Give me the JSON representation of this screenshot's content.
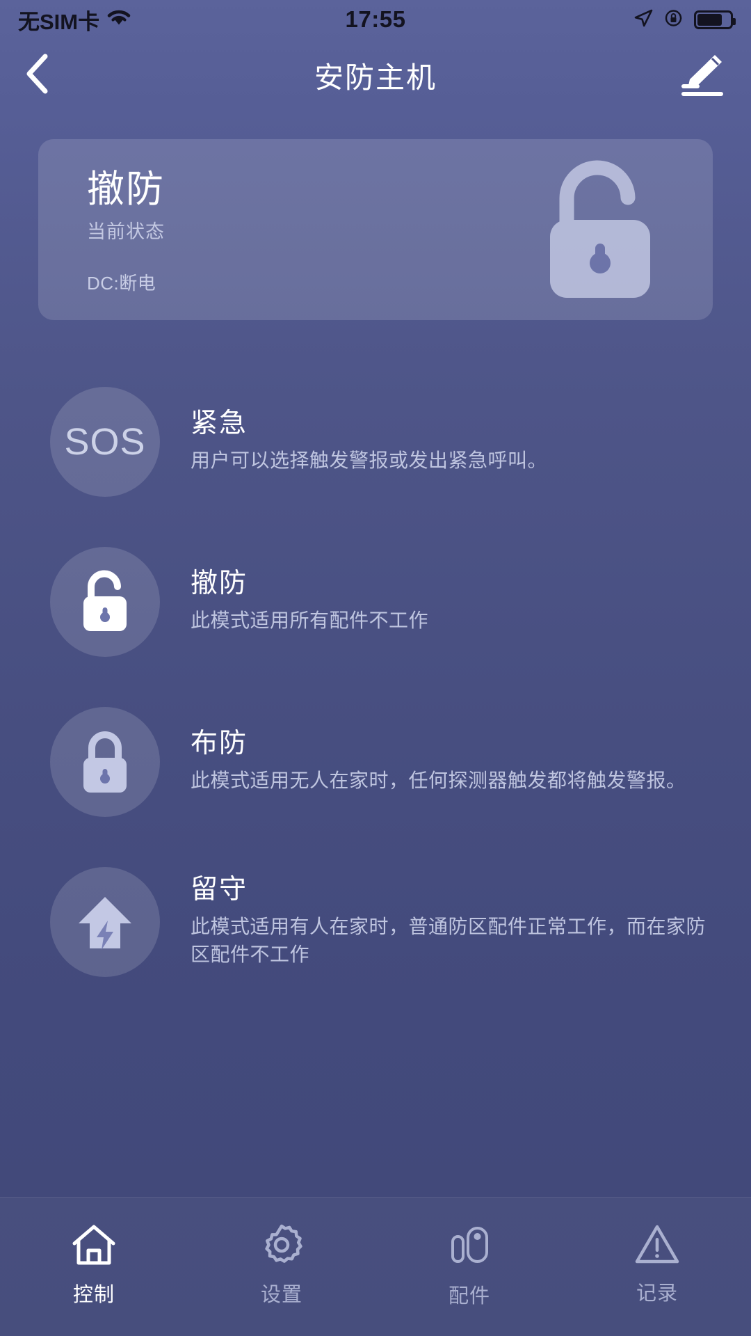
{
  "status_bar": {
    "carrier": "无SIM卡",
    "wifi_icon": "wifi-icon",
    "time": "17:55",
    "location_icon": "location-arrow-icon",
    "rotation_lock_icon": "rotation-lock-icon",
    "battery_icon": "battery-icon",
    "battery_level_pct": 75
  },
  "header": {
    "back_icon": "chevron-left-icon",
    "title": "安防主机",
    "edit_icon": "edit-pencil-icon"
  },
  "status_card": {
    "state": "撤防",
    "sub_label": "当前状态",
    "power_status": "DC:断电",
    "icon": "unlock-open-padlock-icon"
  },
  "modes": [
    {
      "icon": "sos-icon",
      "icon_text": "SOS",
      "title": "紧急",
      "desc": "用户可以选择触发警报或发出紧急呼叫。",
      "active": false
    },
    {
      "icon": "unlock-open-padlock-icon",
      "icon_text": "",
      "title": "撤防",
      "desc": "此模式适用所有配件不工作",
      "active": true
    },
    {
      "icon": "lock-closed-padlock-icon",
      "icon_text": "",
      "title": "布防",
      "desc": "此模式适用无人在家时，任何探测器触发都将触发警报。",
      "active": false
    },
    {
      "icon": "home-bolt-icon",
      "icon_text": "",
      "title": "留守",
      "desc": "此模式适用有人在家时，普通防区配件正常工作，而在家防区配件不工作",
      "active": false
    }
  ],
  "tabs": [
    {
      "icon": "home-icon",
      "label": "控制",
      "active": true
    },
    {
      "icon": "gear-icon",
      "label": "设置",
      "active": false
    },
    {
      "icon": "door-sensor-icon",
      "label": "配件",
      "active": false
    },
    {
      "icon": "warning-triangle-icon",
      "label": "记录",
      "active": false
    }
  ],
  "colors": {
    "background_top": "#5b639b",
    "background_bottom": "#414879",
    "card_overlay": "rgba(255,255,255,0.14)",
    "text_primary": "#ffffff",
    "text_secondary": "#bfc5e0",
    "tab_inactive": "#aab0d0"
  }
}
